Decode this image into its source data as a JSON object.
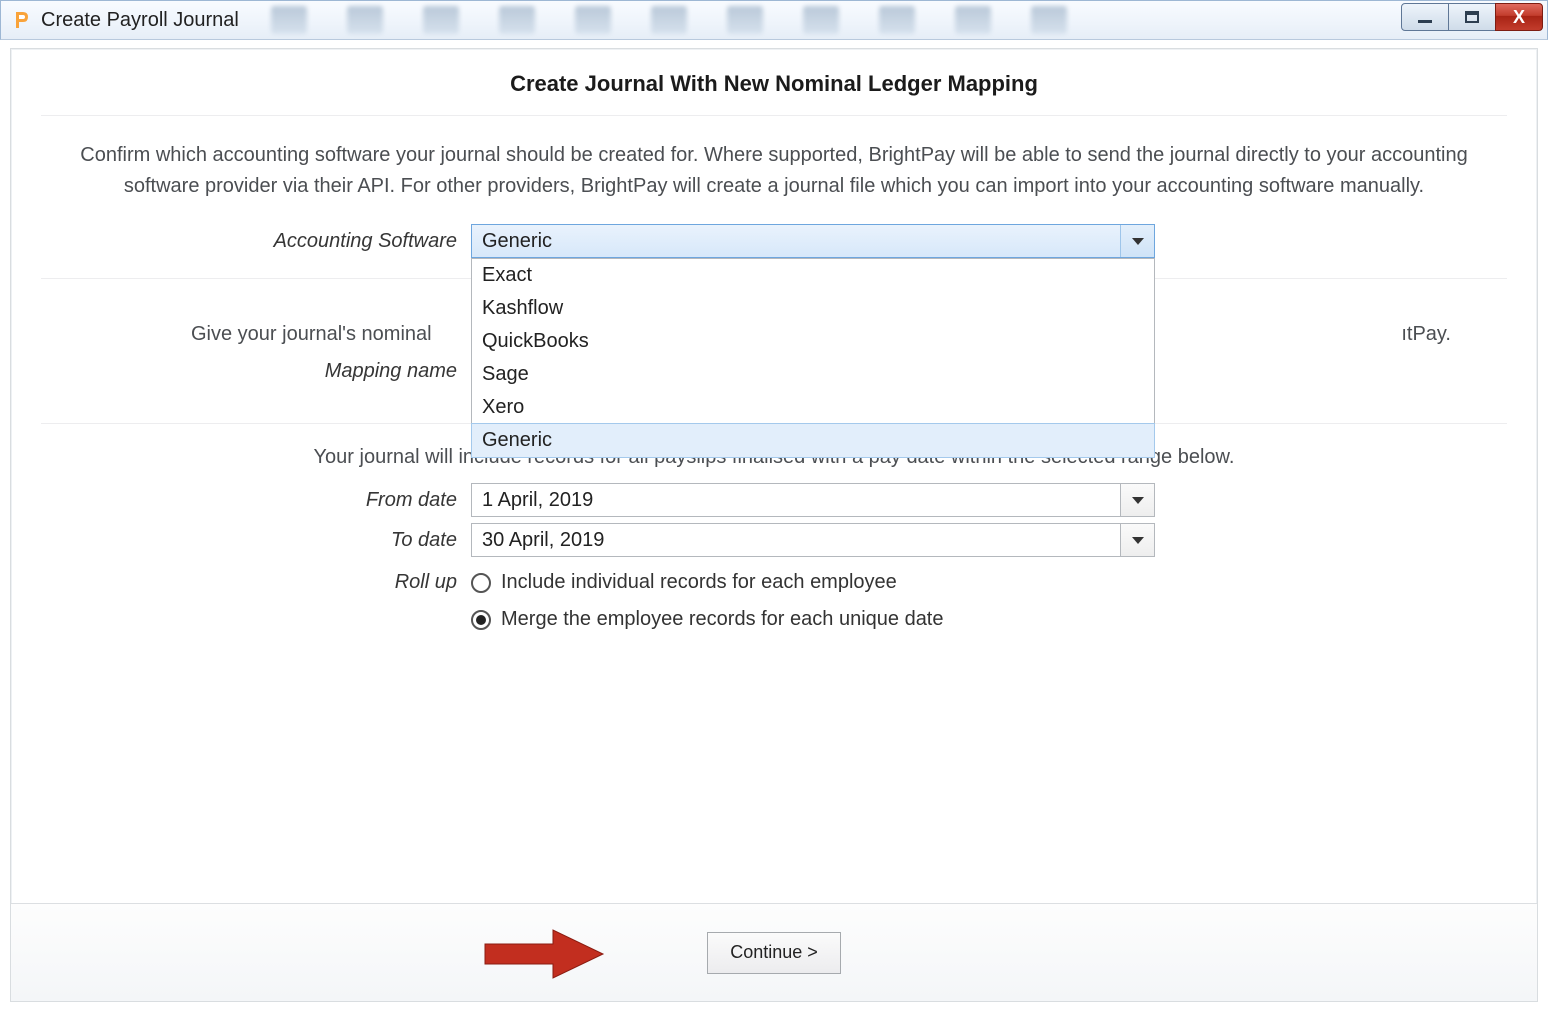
{
  "window": {
    "title": "Create Payroll Journal"
  },
  "heading": "Create Journal With New Nominal Ledger Mapping",
  "intro": "Confirm which accounting software your journal should be created for. Where supported, BrightPay will be able to send the journal directly to your accounting software provider via their API. For other providers, BrightPay will create a journal file which you can import into your accounting software manually.",
  "accounting_software": {
    "label": "Accounting Software",
    "selected": "Generic",
    "options": [
      "Exact",
      "Kashflow",
      "QuickBooks",
      "Sage",
      "Xero",
      "Generic"
    ],
    "highlighted_option": "Generic"
  },
  "mapping_section": {
    "desc_left": "Give your journal's nominal",
    "desc_right_fragment": "ıtPay.",
    "name_label": "Mapping name"
  },
  "daterange_desc": "Your journal will include records for all payslips finalised with a pay date within the selected range below.",
  "from_date": {
    "label": "From date",
    "value": "1 April, 2019"
  },
  "to_date": {
    "label": "To date",
    "value": "30 April, 2019"
  },
  "rollup": {
    "label": "Roll up",
    "option1": "Include individual records for each employee",
    "option2": "Merge the employee records for each unique date",
    "selected_index": 1
  },
  "footer": {
    "continue": "Continue >"
  }
}
